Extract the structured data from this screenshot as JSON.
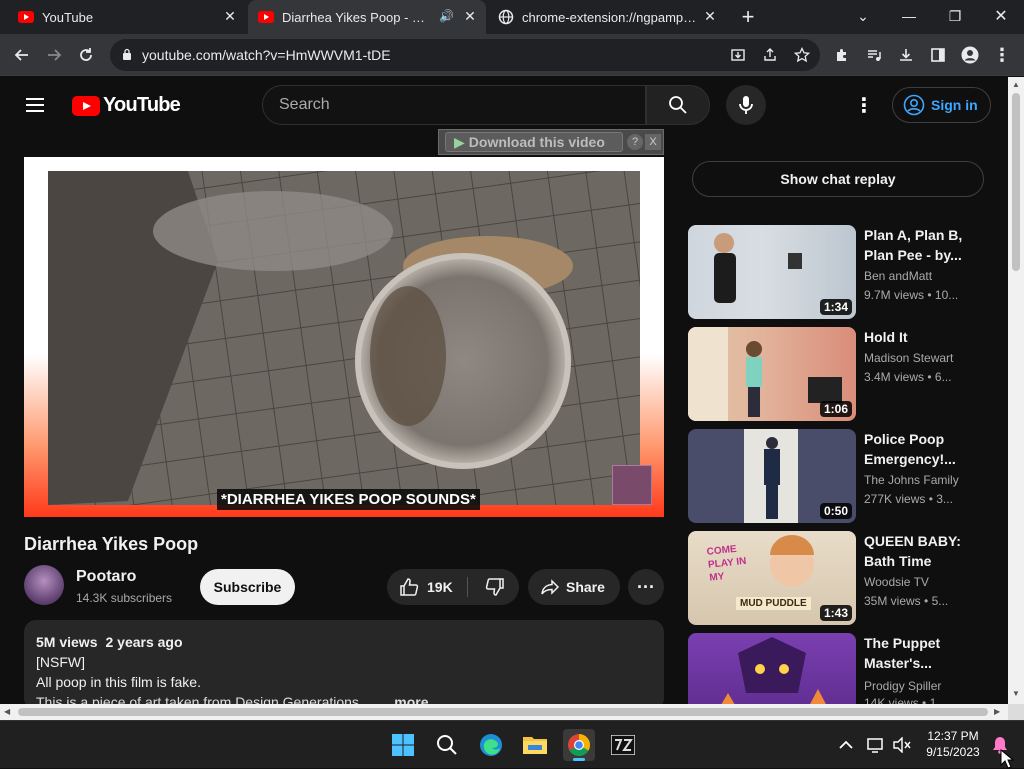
{
  "browser": {
    "tabs": [
      {
        "title": "YouTube"
      },
      {
        "title": "Diarrhea Yikes Poop - YouTube"
      },
      {
        "title": "chrome-extension://ngpampapp"
      }
    ],
    "url": "youtube.com/watch?v=HmWWVM1-tDE",
    "new_tab_symbol": "+"
  },
  "masthead": {
    "logo_text": "YouTube",
    "search_placeholder": "Search",
    "signin_label": "Sign in"
  },
  "downloader": {
    "label": "Download this video",
    "help": "?",
    "close": "X"
  },
  "video": {
    "caption": "*DIARRHEA YIKES POOP SOUNDS*",
    "title": "Diarrhea Yikes Poop",
    "channel": "Pootaro",
    "subscribers": "14.3K subscribers",
    "subscribe_label": "Subscribe",
    "likes": "19K",
    "share_label": "Share",
    "views": "5M views",
    "age": "2 years ago",
    "desc_line1": "[NSFW]",
    "desc_line2": "All poop in this film is fake.",
    "desc_line3": "This is a piece of art taken from Design Generations...",
    "more_label": "...more"
  },
  "sidebar": {
    "chat_replay": "Show chat replay",
    "recommendations": [
      {
        "title": "Plan A, Plan B, Plan Pee - by...",
        "channel": "Ben andMatt",
        "views": "9.7M views",
        "age": "10...",
        "duration": "1:34"
      },
      {
        "title": "Hold It",
        "channel": "Madison Stewart",
        "views": "3.4M views",
        "age": "6...",
        "duration": "1:06"
      },
      {
        "title": "Police Poop Emergency!...",
        "channel": "The Johns Family",
        "views": "277K views",
        "age": "3...",
        "duration": "0:50"
      },
      {
        "title": "QUEEN BABY: Bath Time",
        "channel": "Woodsie TV",
        "views": "35M views",
        "age": "5...",
        "duration": "1:43",
        "thumb_text1": "COME PLAY IN MY",
        "thumb_text2": "MUD PUDDLE"
      },
      {
        "title": "The Puppet Master's...",
        "channel": "Prodigy Spiller",
        "views": "14K views",
        "age": "1...",
        "duration": ""
      }
    ]
  },
  "taskbar": {
    "time": "12:37 PM",
    "date": "9/15/2023"
  },
  "colors": {
    "yt_red": "#ff0000",
    "signin_blue": "#3ea6ff",
    "bg": "#0f0f0f"
  }
}
